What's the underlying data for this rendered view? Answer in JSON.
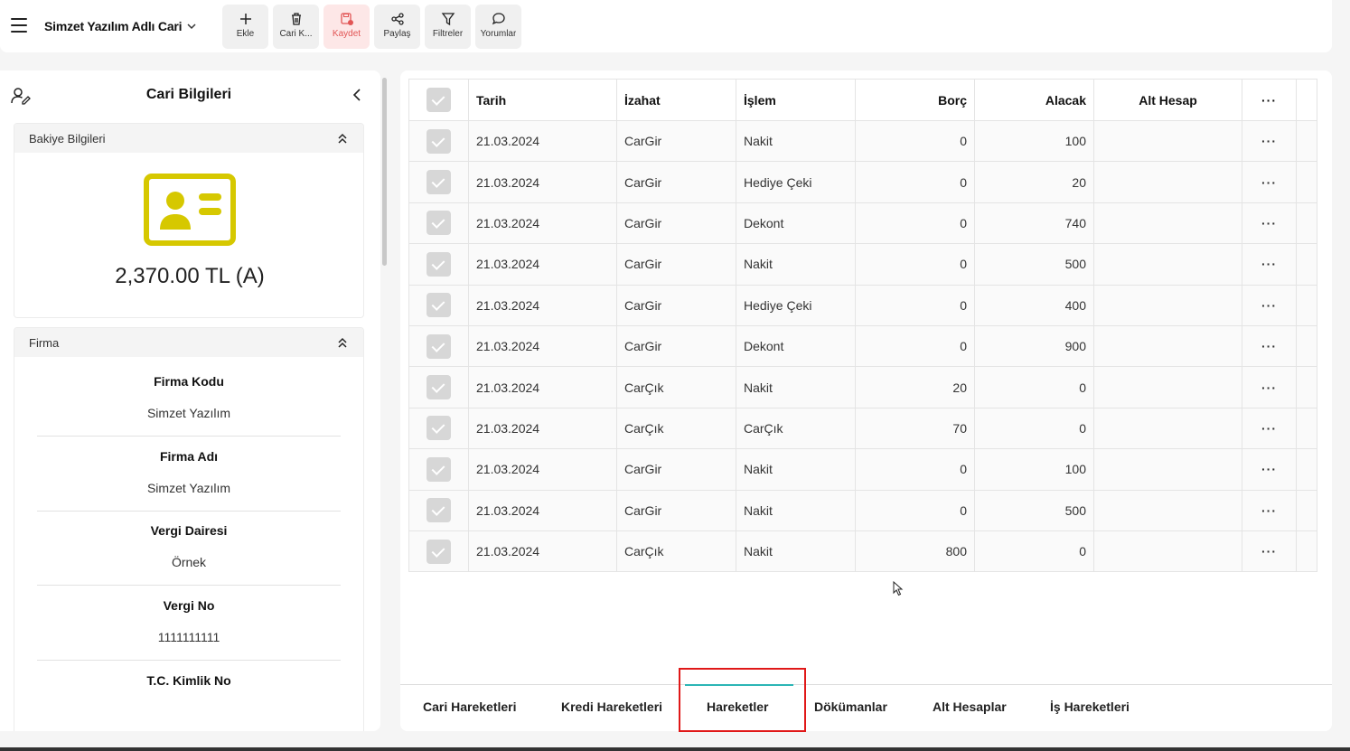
{
  "app": {
    "title": "Simzet Yazılım Adlı Cari"
  },
  "toolbar": {
    "buttons": [
      {
        "label": "Ekle",
        "icon": "plus-icon"
      },
      {
        "label": "Cari K...",
        "icon": "trash-icon"
      },
      {
        "label": "Kaydet",
        "icon": "save-icon"
      },
      {
        "label": "Paylaş",
        "icon": "share-icon"
      },
      {
        "label": "Filtreler",
        "icon": "filter-icon"
      },
      {
        "label": "Yorumlar",
        "icon": "comment-icon"
      }
    ]
  },
  "left_panel": {
    "title": "Cari Bilgileri",
    "balance_section": {
      "label": "Bakiye Bilgileri",
      "amount": "2,370.00 TL (A)"
    },
    "firm_section": {
      "label": "Firma",
      "fields": [
        {
          "key": "Firma Kodu",
          "value": "Simzet Yazılım"
        },
        {
          "key": "Firma Adı",
          "value": "Simzet Yazılım"
        },
        {
          "key": "Vergi Dairesi",
          "value": "Örnek"
        },
        {
          "key": "Vergi No",
          "value": "1111111111"
        },
        {
          "key": "T.C. Kimlik No",
          "value": ""
        }
      ]
    }
  },
  "grid": {
    "columns": [
      "Tarih",
      "İzahat",
      "İşlem",
      "Borç",
      "Alacak",
      "Alt Hesap",
      "···"
    ],
    "rows": [
      {
        "tarih": "21.03.2024",
        "izahat": "CarGir",
        "islem": "Nakit",
        "borc": "0",
        "alacak": "100",
        "alt_hesap": ""
      },
      {
        "tarih": "21.03.2024",
        "izahat": "CarGir",
        "islem": "Hediye Çeki",
        "borc": "0",
        "alacak": "20",
        "alt_hesap": ""
      },
      {
        "tarih": "21.03.2024",
        "izahat": "CarGir",
        "islem": "Dekont",
        "borc": "0",
        "alacak": "740",
        "alt_hesap": ""
      },
      {
        "tarih": "21.03.2024",
        "izahat": "CarGir",
        "islem": "Nakit",
        "borc": "0",
        "alacak": "500",
        "alt_hesap": ""
      },
      {
        "tarih": "21.03.2024",
        "izahat": "CarGir",
        "islem": "Hediye Çeki",
        "borc": "0",
        "alacak": "400",
        "alt_hesap": ""
      },
      {
        "tarih": "21.03.2024",
        "izahat": "CarGir",
        "islem": "Dekont",
        "borc": "0",
        "alacak": "900",
        "alt_hesap": ""
      },
      {
        "tarih": "21.03.2024",
        "izahat": "CarÇık",
        "islem": "Nakit",
        "borc": "20",
        "alacak": "0",
        "alt_hesap": ""
      },
      {
        "tarih": "21.03.2024",
        "izahat": "CarÇık",
        "islem": "CarÇık",
        "borc": "70",
        "alacak": "0",
        "alt_hesap": ""
      },
      {
        "tarih": "21.03.2024",
        "izahat": "CarGir",
        "islem": "Nakit",
        "borc": "0",
        "alacak": "100",
        "alt_hesap": ""
      },
      {
        "tarih": "21.03.2024",
        "izahat": "CarGir",
        "islem": "Nakit",
        "borc": "0",
        "alacak": "500",
        "alt_hesap": ""
      },
      {
        "tarih": "21.03.2024",
        "izahat": "CarÇık",
        "islem": "Nakit",
        "borc": "800",
        "alacak": "0",
        "alt_hesap": ""
      }
    ],
    "row_menu": "···"
  },
  "tabs": {
    "items": [
      "Cari Hareketleri",
      "Kredi Hareketleri",
      "Hareketler",
      "Dökümanlar",
      "Alt Hesaplar",
      "İş Hareketleri"
    ],
    "active": "Hareketler"
  },
  "colors": {
    "accent_teal": "#2bb5b5",
    "id_icon_yellow": "#d6c800",
    "save_red": "#e25555",
    "highlight_red": "#e01818"
  }
}
